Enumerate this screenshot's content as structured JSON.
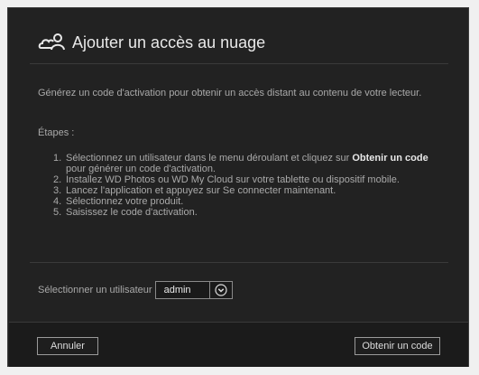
{
  "dialog": {
    "title": "Ajouter un accès au nuage",
    "title_icon": "cloud-user-icon",
    "intro": "Générez un code d'activation pour obtenir un accès distant au contenu de votre lecteur.",
    "steps_label": "Étapes :",
    "steps": [
      {
        "num": "1.",
        "text_before": "Sélectionnez un utilisateur dans le menu déroulant et cliquez sur ",
        "bold": "Obtenir un code",
        "text_after": " pour générer un code d'activation."
      },
      {
        "num": "2.",
        "text": "Installez WD Photos ou WD My Cloud sur votre tablette ou dispositif mobile."
      },
      {
        "num": "3.",
        "text": "Lancez l'application et appuyez sur Se connecter maintenant."
      },
      {
        "num": "4.",
        "text": "Sélectionnez votre produit."
      },
      {
        "num": "5.",
        "text": "Saisissez le code d'activation."
      }
    ],
    "user_select": {
      "label": "Sélectionner un utilisateur",
      "value": "admin",
      "arrow_icon": "chevron-down-circle-icon"
    },
    "buttons": {
      "cancel": "Annuler",
      "get_code": "Obtenir un code"
    }
  },
  "colors": {
    "dialog_bg": "#222222",
    "text": "#a9a9a9",
    "title": "#e8e8e8",
    "border": "#9a9a9a"
  }
}
